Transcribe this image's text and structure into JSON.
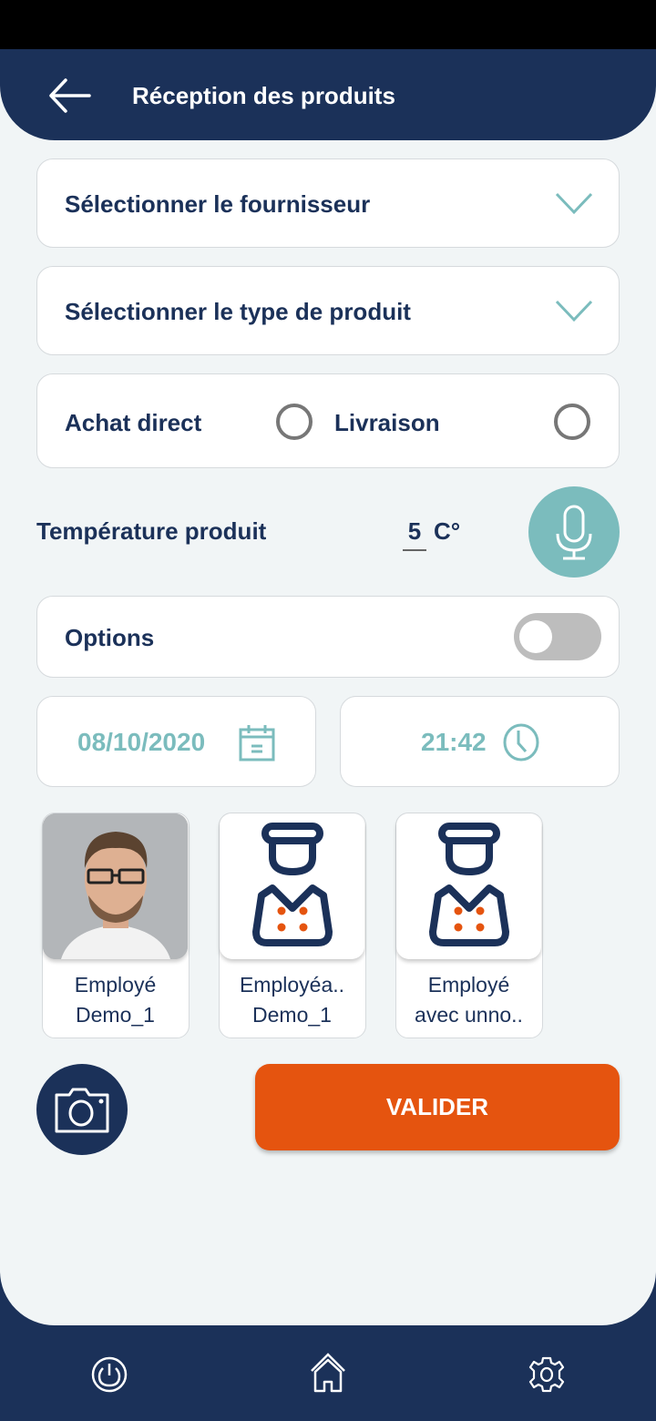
{
  "header": {
    "title": "Réception des produits",
    "back_icon": "arrow-left-icon"
  },
  "form": {
    "supplier_select": {
      "placeholder": "Sélectionner le fournisseur",
      "icon": "chevron-down-icon"
    },
    "product_type_select": {
      "placeholder": "Sélectionner le type de produit",
      "icon": "chevron-down-icon"
    },
    "purchase_mode": {
      "options": [
        {
          "label": "Achat direct",
          "selected": false
        },
        {
          "label": "Livraison",
          "selected": false
        }
      ]
    },
    "temperature": {
      "label": "Température produit",
      "value": "5",
      "unit": "C°",
      "mic_icon": "microphone-icon"
    },
    "options": {
      "label": "Options",
      "enabled": false
    },
    "date": {
      "value": "08/10/2020",
      "icon": "calendar-icon"
    },
    "time": {
      "value": "21:42",
      "icon": "clock-icon"
    }
  },
  "employees": [
    {
      "line1": "Employé",
      "line2": "Demo_1",
      "avatar": "photo"
    },
    {
      "line1": "Employéa..",
      "line2": "Demo_1",
      "avatar": "chef-icon"
    },
    {
      "line1": "Employé",
      "line2": "avec unno..",
      "avatar": "chef-icon"
    }
  ],
  "actions": {
    "camera_icon": "camera-icon",
    "validate_label": "VALIDER"
  },
  "colors": {
    "primary": "#1b3159",
    "accent": "#7bbcbd",
    "action": "#e5540f",
    "background": "#f1f5f6"
  },
  "bottom_nav": [
    {
      "name": "power",
      "icon": "power-icon"
    },
    {
      "name": "home",
      "icon": "home-icon"
    },
    {
      "name": "settings",
      "icon": "gear-icon"
    }
  ]
}
